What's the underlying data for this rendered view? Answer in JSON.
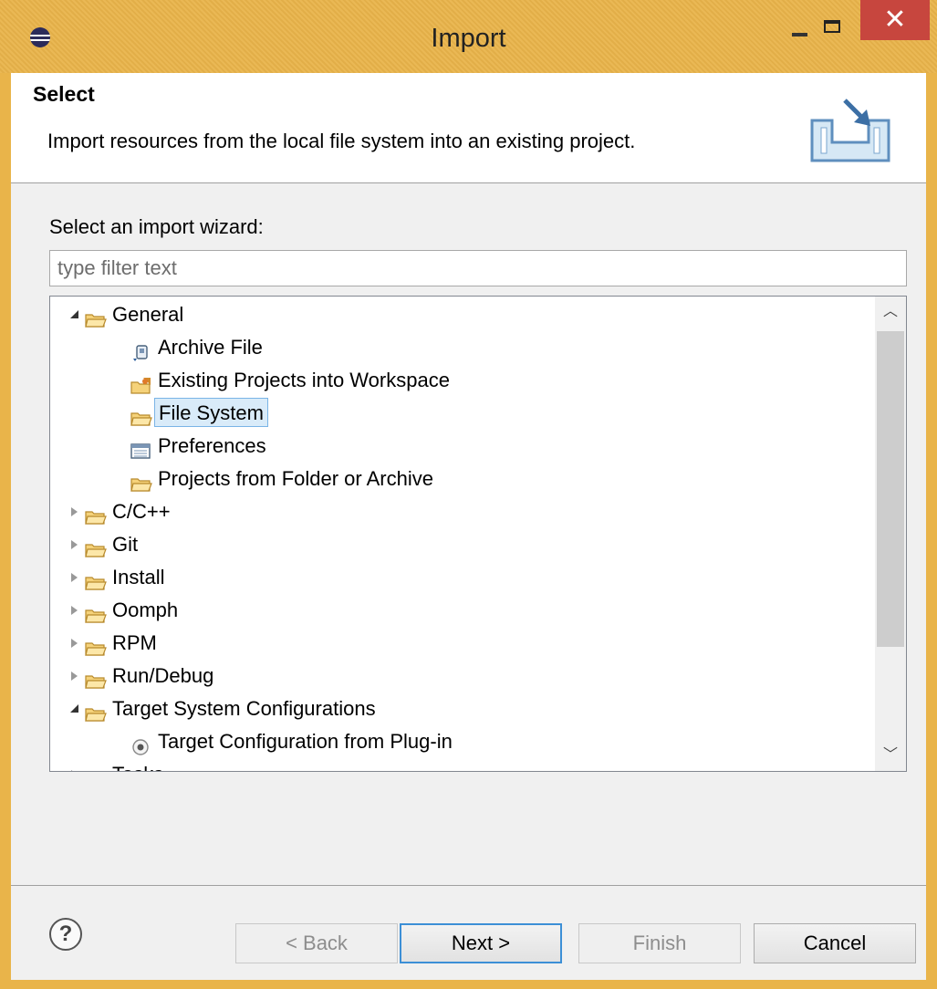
{
  "window": {
    "title": "Import",
    "close_label": "✕"
  },
  "header": {
    "title": "Select",
    "description": "Import resources from the local file system into an existing project."
  },
  "wizard": {
    "label": "Select an import wizard:",
    "filter_placeholder": "type filter text",
    "filter_value": ""
  },
  "tree": {
    "items": [
      {
        "label": "General",
        "level": 0,
        "state": "expanded",
        "icon": "folder-icon"
      },
      {
        "label": "Archive File",
        "level": 1,
        "icon": "archive-icon"
      },
      {
        "label": "Existing Projects into Workspace",
        "level": 1,
        "icon": "existing-projects-icon"
      },
      {
        "label": "File System",
        "level": 1,
        "icon": "folder-icon",
        "selected": true
      },
      {
        "label": "Preferences",
        "level": 1,
        "icon": "preferences-icon"
      },
      {
        "label": "Projects from Folder or Archive",
        "level": 1,
        "icon": "folder-icon"
      },
      {
        "label": "C/C++",
        "level": 0,
        "state": "collapsed",
        "icon": "folder-icon"
      },
      {
        "label": "Git",
        "level": 0,
        "state": "collapsed",
        "icon": "folder-icon"
      },
      {
        "label": "Install",
        "level": 0,
        "state": "collapsed",
        "icon": "folder-icon"
      },
      {
        "label": "Oomph",
        "level": 0,
        "state": "collapsed",
        "icon": "folder-icon"
      },
      {
        "label": "RPM",
        "level": 0,
        "state": "collapsed",
        "icon": "folder-icon"
      },
      {
        "label": "Run/Debug",
        "level": 0,
        "state": "collapsed",
        "icon": "folder-icon"
      },
      {
        "label": "Target System Configurations",
        "level": 0,
        "state": "expanded",
        "icon": "folder-icon"
      },
      {
        "label": "Target Configuration from Plug-in",
        "level": 1,
        "icon": "target-icon"
      },
      {
        "label": "Tasks",
        "level": 0,
        "state": "collapsed",
        "icon": "folder-icon"
      }
    ]
  },
  "buttons": {
    "help": "?",
    "back": "< Back",
    "next": "Next >",
    "finish": "Finish",
    "cancel": "Cancel"
  },
  "colors": {
    "title_bar": "#e9b44a",
    "close_button": "#c7463e",
    "selection_bg": "#d9ebf9",
    "selection_border": "#7ab4e6",
    "default_button_border": "#3c8fd6"
  }
}
